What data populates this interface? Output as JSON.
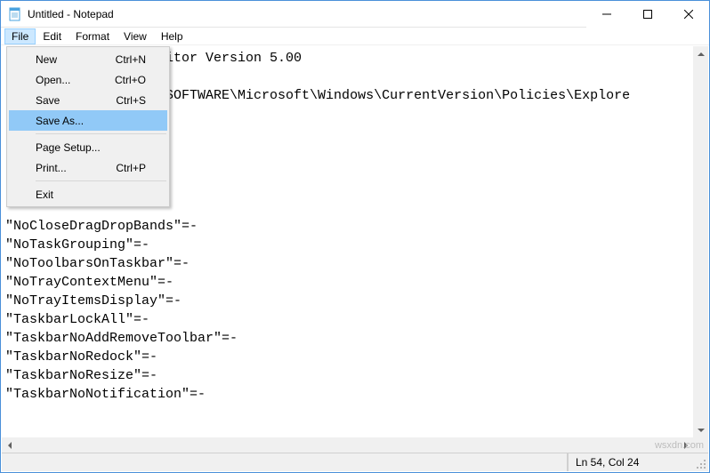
{
  "window": {
    "title": "Untitled - Notepad"
  },
  "menubar": {
    "items": [
      "File",
      "Edit",
      "Format",
      "View",
      "Help"
    ]
  },
  "file_menu": {
    "new": {
      "label": "New",
      "shortcut": "Ctrl+N"
    },
    "open": {
      "label": "Open...",
      "shortcut": "Ctrl+O"
    },
    "save": {
      "label": "Save",
      "shortcut": "Ctrl+S"
    },
    "save_as": {
      "label": "Save As...",
      "shortcut": ""
    },
    "page_setup": {
      "label": "Page Setup...",
      "shortcut": ""
    },
    "print": {
      "label": "Print...",
      "shortcut": "Ctrl+P"
    },
    "exit": {
      "label": "Exit",
      "shortcut": ""
    }
  },
  "editor": {
    "lines": [
      "                   ditor Version 5.00",
      "",
      "                   \\SOFTWARE\\Microsoft\\Windows\\CurrentVersion\\Policies\\Explore",
      "",
      "",
      "",
      "",
      "",
      "",
      "\"NoCloseDragDropBands\"=-",
      "\"NoTaskGrouping\"=-",
      "\"NoToolbarsOnTaskbar\"=-",
      "\"NoTrayContextMenu\"=-",
      "\"NoTrayItemsDisplay\"=-",
      "\"TaskbarLockAll\"=-",
      "\"TaskbarNoAddRemoveToolbar\"=-",
      "\"TaskbarNoRedock\"=-",
      "\"TaskbarNoResize\"=-",
      "\"TaskbarNoNotification\"=-"
    ]
  },
  "statusbar": {
    "cursor": "Ln 54, Col 24"
  },
  "watermark": "wsxdn.com"
}
